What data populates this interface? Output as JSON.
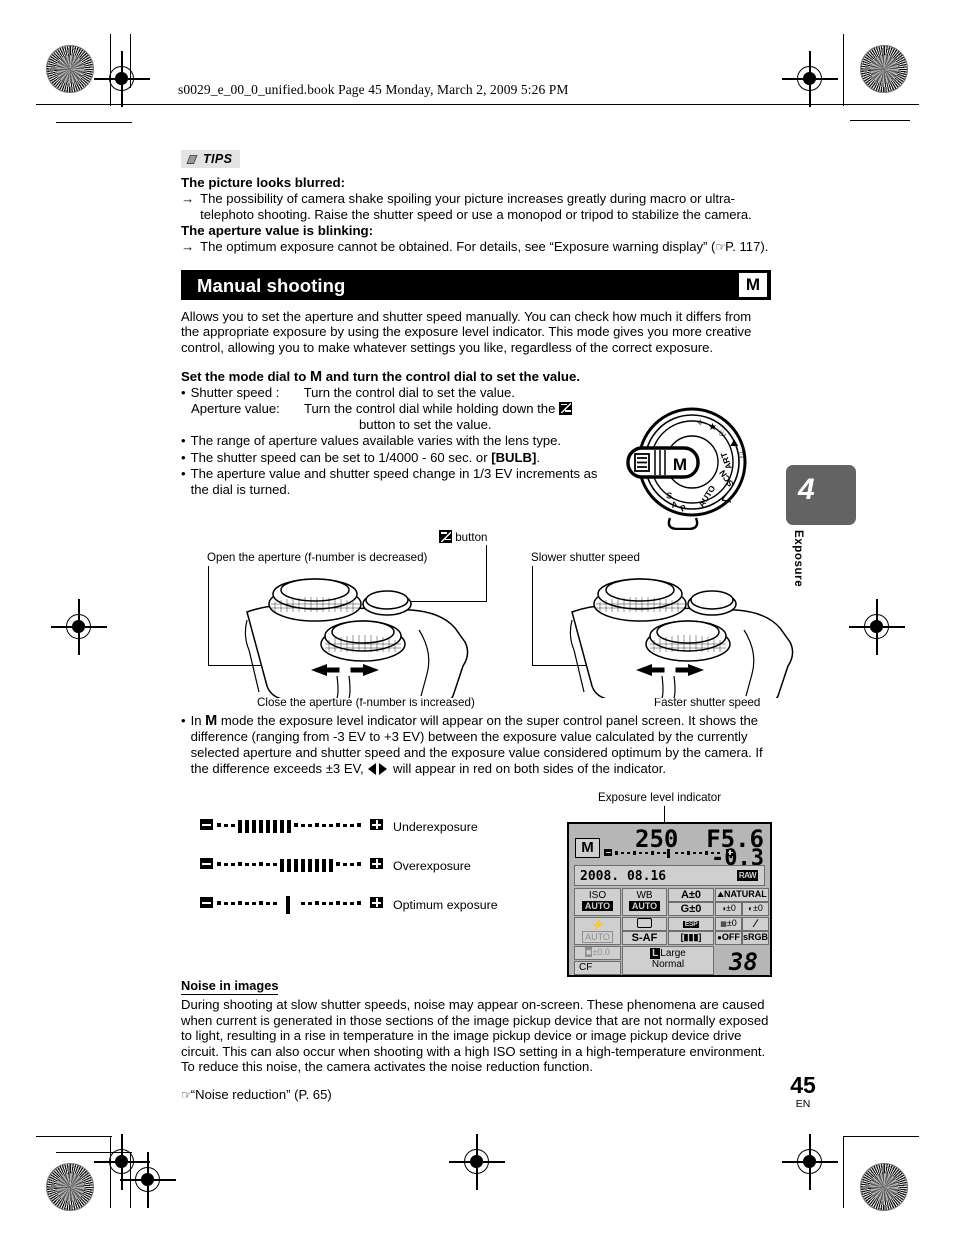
{
  "header": {
    "file_line": "s0029_e_00_0_unified.book  Page 45  Monday, March 2, 2009  5:26 PM"
  },
  "tips": {
    "badge_label": "TIPS",
    "badge_icon": "book-icon",
    "entries": [
      {
        "heading": "The picture looks blurred:",
        "arrow": "→",
        "body": "The possibility of camera shake spoiling your picture increases greatly during macro or ultra-telephoto shooting. Raise the shutter speed or use a monopod or tripod to stabilize the camera."
      },
      {
        "heading": "The aperture value is blinking:",
        "arrow": "→",
        "body_pre": "The optimum exposure cannot be obtained. For details, see “Exposure warning display” (",
        "body_ref": "P. 117).",
        "ref_icon": "pointing-hand-icon"
      }
    ]
  },
  "section": {
    "title": "Manual shooting",
    "badge": "M",
    "intro": "Allows you to set the aperture and shutter speed manually. You can check how much it differs from the appropriate exposure by using the exposure level indicator. This mode gives you more creative control, allowing you to make whatever settings you like, regardless of the correct exposure."
  },
  "step": {
    "title_pre": "Set the mode dial to ",
    "title_glyph": "M",
    "title_post": " and turn the control dial to set the value.",
    "bullets": [
      {
        "bullet": "•",
        "label": "Shutter speed :",
        "text": "Turn the control dial to set the value."
      },
      {
        "bullet": "",
        "label": "Aperture value:",
        "text_pre": "Turn the control dial while holding down the ",
        "icon": "exposure-compensation-icon",
        "text_post": "button to set the value."
      },
      {
        "bullet": "•",
        "text": "The range of aperture values available varies with the lens type."
      },
      {
        "bullet": "•",
        "text_pre": "The shutter speed can be set to 1/4000 - 60 sec. or ",
        "text_bold": "[BULB]",
        "text_post": "."
      },
      {
        "bullet": "•",
        "text": "The aperture value and shutter speed change in 1/3 EV increments as the dial is turned."
      }
    ]
  },
  "mode_dial": {
    "selected": "M",
    "labels": [
      "AUTO",
      "P",
      "A",
      "S",
      "M",
      "ART",
      "SCN"
    ]
  },
  "side_tab": {
    "number": "4",
    "label": "Exposure"
  },
  "camera_figures": {
    "ev_button_label": "button",
    "ev_button_icon": "exposure-compensation-icon",
    "left": {
      "top_label": "Open the aperture (f-number is decreased)",
      "bottom_label": "Close the aperture (f-number is increased)"
    },
    "right": {
      "top_label": "Slower shutter speed",
      "bottom_label": "Faster shutter speed"
    }
  },
  "mode_note": {
    "bullet": "•",
    "pre": "In ",
    "glyph": "M",
    "mid": " mode the exposure level indicator will appear on the super control panel screen. It shows the difference (ranging from -3 EV to +3 EV) between the exposure value calculated by the currently selected aperture and shutter speed and the exposure value considered optimum by the camera. If the difference exceeds ±3 EV, ",
    "icon": "left-right-arrows-icon",
    "post": " will appear in red on both sides of the indicator."
  },
  "exposure_indicator": {
    "callout": "Exposure level indicator",
    "rows": [
      {
        "label": "Underexposure",
        "fill_from": -3.0,
        "fill_to": -0.7,
        "pointer": null
      },
      {
        "label": "Overexposure",
        "fill_from": 0.3,
        "fill_to": 2.5,
        "pointer": null
      },
      {
        "label": "Optimum exposure",
        "fill_from": null,
        "fill_to": null,
        "pointer": 0
      }
    ],
    "minus_cap": "minus-icon",
    "plus_cap": "plus-icon"
  },
  "lcd": {
    "mode": "M",
    "shutter": "250",
    "aperture": "F5.6",
    "exposure_comp": "-0.3",
    "date": "2008. 08.16",
    "quality_badge": "RAW",
    "grid": {
      "iso_label": "ISO",
      "iso_value": "AUTO",
      "wb_label": "WB",
      "wb_value": "AUTO",
      "wb_a": "A±0",
      "wb_g": "G±0",
      "picture_mode": "NATURAL",
      "contrast": "±0",
      "sharpness": "±0",
      "flash_value": "AUTO",
      "drive_icon": "single-frame-icon",
      "metering_icon": "esp-metering-icon",
      "af_mode": "S-AF",
      "af_area_icon": "af-area-icon",
      "saturation": "±0",
      "gradation_icon": "gradation-icon",
      "noise_filter": "OFF",
      "color_space": "sRGB",
      "flash_comp": "±0.0",
      "card": "CF",
      "image_size": "Large",
      "image_quality": "Normal",
      "frames_remaining": "38"
    }
  },
  "noise": {
    "heading": "Noise in images",
    "body": "During shooting at slow shutter speeds, noise may appear on-screen. These phenomena are caused when current is generated in those sections of the image pickup device that are not normally exposed to light, resulting in a rise in temperature in the image pickup device or image pickup device drive circuit. This can also occur when shooting with a high ISO setting in a high-temperature environment. To reduce this noise, the camera activates the noise reduction function.",
    "reference": "“Noise reduction” (P. 65)",
    "reference_icon": "pointing-hand-icon"
  },
  "footer": {
    "page_number": "45",
    "language": "EN"
  },
  "colors": {
    "banner_bg": "#000000",
    "tips_bg": "#e3e3e3",
    "tab_bg": "#636363",
    "lcd_bg": "#b6b6b6",
    "lcd_cell": "#cfcfcf"
  }
}
